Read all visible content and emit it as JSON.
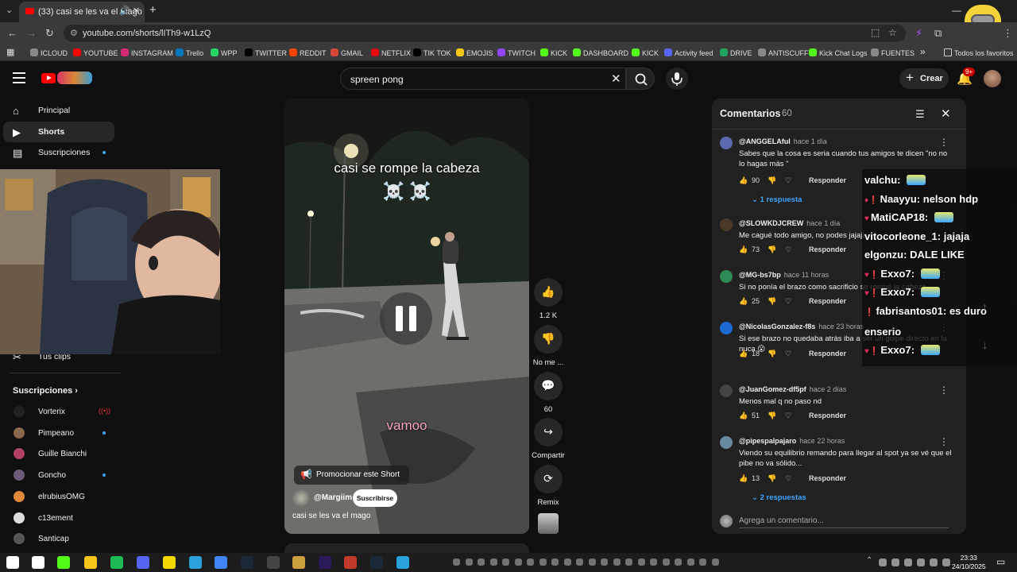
{
  "browser": {
    "tab_title": "(33) casi se les va el mago",
    "url": "youtube.com/shorts/lITh9-w1LzQ",
    "bookmarks": [
      "ICLOUD",
      "YOUTUBE",
      "INSTAGRAM",
      "Trello",
      "WPP",
      "TWITTER",
      "REDDIT",
      "GMAIL",
      "NETFLIX",
      "TIK TOK",
      "EMOJIS",
      "TWITCH",
      "KICK",
      "DASHBOARD",
      "KICK",
      "Activity feed",
      "DRIVE",
      "ANTISCUFF",
      "Kick Chat Logs",
      "FUENTES"
    ],
    "bookmarks_more": "»",
    "bookmarks_folder": "Todos los favoritos"
  },
  "header": {
    "search_value": "spreen pong",
    "create_label": "Crear",
    "notif_badge": "9+"
  },
  "sidebar": {
    "items": [
      {
        "label": "Principal",
        "icon": "home-icon"
      },
      {
        "label": "Shorts",
        "icon": "shorts-icon"
      },
      {
        "label": "Suscripciones",
        "icon": "subscriptions-icon"
      }
    ],
    "clips_label": "Tus clips",
    "subs_title": "Suscripciones",
    "subs": [
      {
        "label": "Vorterix",
        "color": "#222"
      },
      {
        "label": "Pimpeano",
        "color": "#8a6a4a"
      },
      {
        "label": "Guille Bianchi",
        "color": "#b04060"
      },
      {
        "label": "Goncho",
        "color": "#6a5a7a"
      },
      {
        "label": "elrubiusOMG",
        "color": "#e08a3a"
      },
      {
        "label": "c13ement",
        "color": "#ddd"
      },
      {
        "label": "Santicap",
        "color": "#555"
      }
    ]
  },
  "video": {
    "caption_top": "casi se rompe la cabeza",
    "caption_skulls": "☠️ ☠️",
    "caption_mid": "vamoo",
    "promote_label": "Promocionar este Short",
    "channel": "@Margiim",
    "subscribe_label": "Suscribirse",
    "title": "casi se les va el mago"
  },
  "actions": {
    "likes": "1.2 K",
    "dislike": "No me ...",
    "comments": "60",
    "share": "Compartir",
    "remix": "Remix"
  },
  "comments": {
    "title": "Comentarios",
    "count": "60",
    "reply_label": "Responder",
    "add_placeholder": "Agrega un comentario...",
    "items": [
      {
        "author": "@ANGGELAful",
        "time": "hace 1 día",
        "text": "Sabes que la cosa es seria cuando tus amigos te dicen \"no no lo hagas más \"",
        "likes": "90",
        "replies": "1 respuesta",
        "color": "#5a6ab0"
      },
      {
        "author": "@SLOWKDJCREW",
        "time": "hace 1 día",
        "text": "Me cagué todo amigo, no podes jajaja",
        "likes": "73",
        "replies": "",
        "color": "#4a3a2a"
      },
      {
        "author": "@MG-bs7bp",
        "time": "hace 11 horas",
        "text": "Si no ponía el brazo como sacrificio se rompe la cabeza",
        "likes": "25",
        "replies": "",
        "color": "#2e8b57"
      },
      {
        "author": "@NicolasGonzalez-f8s",
        "time": "hace 23 horas",
        "text": "Si ese brazo no quedaba atrás iba a ser un golpe directo en la nuca 😮",
        "likes": "18",
        "replies": "",
        "color": "#1e6ad0"
      },
      {
        "author": "@JuanGomez-df5pf",
        "time": "hace 2 días",
        "text": "Menos mal q no paso nd",
        "likes": "51",
        "replies": "",
        "color": "#444"
      },
      {
        "author": "@pipespalpajaro",
        "time": "hace 22 horas",
        "text": "Viendo su equilibrio remando para llegar al spot ya se vé que el pibe no va sólido...",
        "likes": "13",
        "replies": "2 respuestas",
        "color": "#6a8aa0"
      }
    ]
  },
  "chat": [
    {
      "user": "valchu:",
      "msg": "",
      "emote": true,
      "badges": ""
    },
    {
      "user": "Naayyu:",
      "msg": "nelson hdp",
      "emote": false,
      "badges": "♦❗"
    },
    {
      "user": "MatiCAP18:",
      "msg": "",
      "emote": true,
      "badges": "♥"
    },
    {
      "user": "vitocorleone_1:",
      "msg": "jajaja",
      "emote": false,
      "badges": ""
    },
    {
      "user": "elgonzu:",
      "msg": "DALE LIKE",
      "emote": false,
      "badges": ""
    },
    {
      "user": "Exxo7:",
      "msg": "",
      "emote": true,
      "badges": "♥❗"
    },
    {
      "user": "Exxo7:",
      "msg": "",
      "emote": true,
      "badges": "♥❗"
    },
    {
      "user": "fabrisantos01:",
      "msg": "es duro",
      "emote": false,
      "badges": "❗"
    },
    {
      "user": "enserio",
      "msg": "",
      "emote": false,
      "badges": ""
    },
    {
      "user": "Exxo7:",
      "msg": "",
      "emote": true,
      "badges": "♥❗"
    }
  ],
  "taskbar": {
    "time": "23:33",
    "date": "24/10/2025"
  },
  "colors": {
    "accent_blue": "#3ea6ff",
    "yt_red": "#ff0000"
  }
}
